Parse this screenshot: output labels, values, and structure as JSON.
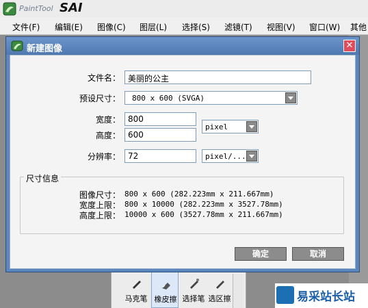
{
  "app": {
    "name_small": "PaintTool",
    "name_big": "SAI"
  },
  "menu": [
    {
      "label": "文件(F)"
    },
    {
      "label": "编辑(E)"
    },
    {
      "label": "图像(C)"
    },
    {
      "label": "图层(L)"
    },
    {
      "label": "选择(S)"
    },
    {
      "label": "滤镜(T)"
    },
    {
      "label": "视图(V)"
    },
    {
      "label": "窗口(W)"
    },
    {
      "label": "其他"
    }
  ],
  "dialog": {
    "title": "新建图像",
    "close_glyph": "✕",
    "filename_label": "文件名：",
    "filename_value": "美丽的公主",
    "preset_label": "预设尺寸：",
    "preset_value": "800 x  600  (SVGA)",
    "width_label": "宽度：",
    "width_value": "800",
    "height_label": "高度：",
    "height_value": "600",
    "unit_value": "pixel",
    "resolution_label": "分辨率：",
    "resolution_value": "72",
    "resolution_unit": "pixel/...",
    "info_title": "尺寸信息",
    "info": [
      {
        "label": "图像尺寸：",
        "value": "800 x 600  (282.223mm x 211.667mm)"
      },
      {
        "label": "宽度上限：",
        "value": "800 x 10000  (282.223mm x 3527.78mm)"
      },
      {
        "label": "高度上限：",
        "value": "10000 x 600  (3527.78mm x 211.667mm)"
      }
    ],
    "ok_label": "确定",
    "cancel_label": "取消"
  },
  "tools": [
    {
      "label": "马克笔",
      "icon": "marker-icon"
    },
    {
      "label": "橡皮擦",
      "icon": "eraser-icon",
      "active": true
    },
    {
      "label": "选择笔",
      "icon": "select-pen-icon"
    },
    {
      "label": "选区擦",
      "icon": "select-eraser-icon"
    }
  ],
  "watermark": {
    "text": "易采站长站"
  },
  "colors": {
    "dialog_title": "#5b86bd",
    "close": "#e04c5c",
    "button": "#8c8c8c"
  }
}
